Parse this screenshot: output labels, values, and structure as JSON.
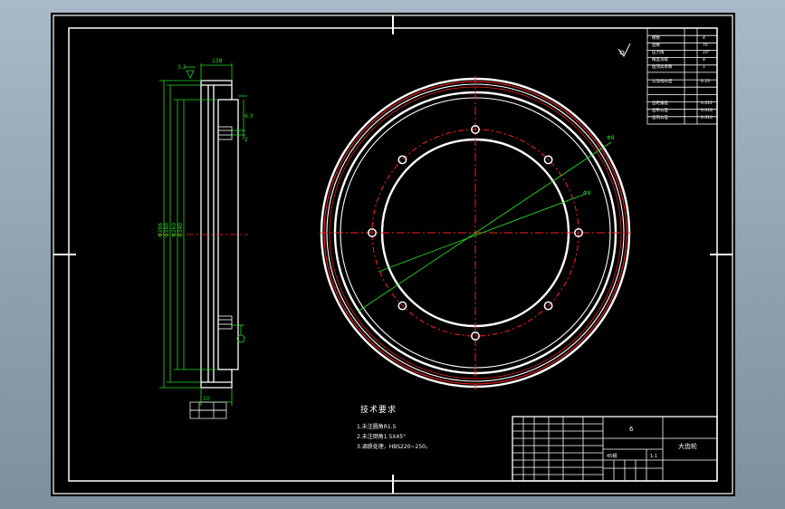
{
  "drawing": {
    "title_block": {
      "part_name": "大齿轮",
      "drawing_no": "6",
      "material": "45钢",
      "scale": "1:1"
    },
    "tech_requirements": {
      "heading": "技术要求",
      "items": [
        "1.未注圆角R1.5",
        "2.未注倒角1.5X45°",
        "3.调质处理，HBS220~250。"
      ]
    },
    "param_table_rows": 13,
    "hole_count": 8
  },
  "colors": {
    "background": "#000000",
    "outline": "#ffffff",
    "centerline": "#ff2020",
    "dimension": "#22dd22"
  }
}
